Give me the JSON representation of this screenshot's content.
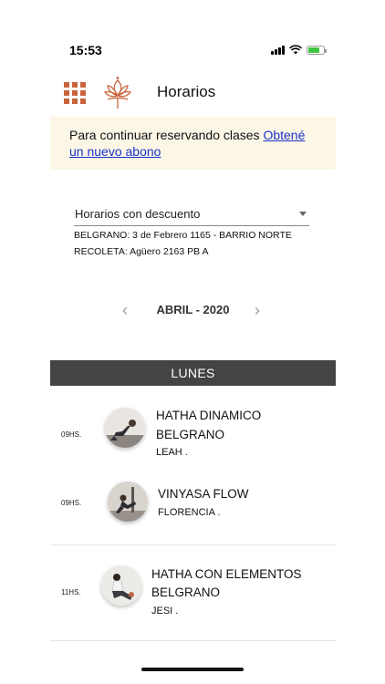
{
  "status_bar": {
    "time": "15:53"
  },
  "header": {
    "title": "Horarios",
    "menu_icon": "grid-icon",
    "logo_icon": "lotus-icon"
  },
  "banner": {
    "text": "Para continuar reservando clases ",
    "link": "Obtené un nuevo abono"
  },
  "filter": {
    "selected": "Horarios con descuento",
    "locations": [
      "BELGRANO: 3 de Febrero 1165 - BARRIO NORTE",
      "RECOLETA: Agüero 2163 PB A"
    ]
  },
  "month_nav": {
    "label": "ABRIL - 2020",
    "prev": "‹",
    "next": "›"
  },
  "day": {
    "label": "LUNES"
  },
  "classes": [
    {
      "time": "09HS.",
      "name": "HATHA DINAMICO",
      "location": "BELGRANO",
      "teacher": "LEAH ."
    },
    {
      "time": "09HS.",
      "name": "VINYASA FLOW",
      "location": "",
      "teacher": "FLORENCIA ."
    },
    {
      "time": "11HS.",
      "name": "HATHA CON ELEMENTOS",
      "location": "BELGRANO",
      "teacher": "JESI ."
    }
  ],
  "colors": {
    "accent": "#c8643b",
    "banner_bg": "#fcf6e6",
    "link": "#1a33cc",
    "day_header_bg": "#444444"
  }
}
